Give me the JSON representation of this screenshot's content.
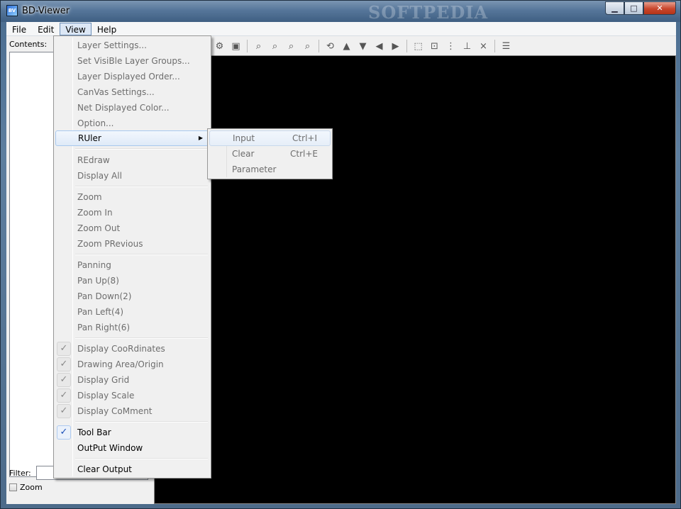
{
  "window": {
    "title": "BD-Viewer",
    "icon_text": "BV",
    "watermark": "SOFTPEDIA",
    "buttons": {
      "minimize": "▁",
      "maximize": "□",
      "close": "✕"
    }
  },
  "menubar": {
    "file": "File",
    "edit": "Edit",
    "view": "View",
    "help": "Help"
  },
  "left_panel": {
    "contents_label": "Contents:",
    "filter_label": "Filter:",
    "zoom_label": "Zoom",
    "zoom_checked": false
  },
  "view_menu": {
    "items": [
      {
        "label": "Layer Settings..."
      },
      {
        "label": "Set VisiBle Layer Groups..."
      },
      {
        "label": "Layer Displayed Order..."
      },
      {
        "label": "CanVas Settings..."
      },
      {
        "label": "Net Displayed Color..."
      },
      {
        "label": "Option..."
      },
      {
        "label": "RUler"
      },
      {
        "label": "REdraw"
      },
      {
        "label": "Display All"
      },
      {
        "label": "Zoom"
      },
      {
        "label": "Zoom In"
      },
      {
        "label": "Zoom Out"
      },
      {
        "label": "Zoom PRevious"
      },
      {
        "label": "Panning"
      },
      {
        "label": "Pan Up(8)"
      },
      {
        "label": "Pan Down(2)"
      },
      {
        "label": "Pan Left(4)"
      },
      {
        "label": "Pan Right(6)"
      },
      {
        "label": "Display CooRdinates"
      },
      {
        "label": "Drawing Area/Origin"
      },
      {
        "label": "Display Grid"
      },
      {
        "label": "Display Scale"
      },
      {
        "label": "Display CoMment"
      },
      {
        "label": "Tool Bar"
      },
      {
        "label": "OutPut Window"
      },
      {
        "label": "Clear Output"
      }
    ],
    "check_glyph": "✓"
  },
  "ruler_submenu": {
    "items": [
      {
        "label": "Input",
        "shortcut": "Ctrl+I"
      },
      {
        "label": "Clear",
        "shortcut": "Ctrl+E"
      },
      {
        "label": "Parameter",
        "shortcut": ""
      }
    ]
  },
  "toolbar": {
    "icons": [
      "settings-icon",
      "layer-icon",
      "zoom-icon",
      "zoom-in-icon",
      "zoom-out-icon",
      "zoom-previous-icon",
      "redraw-icon",
      "pan-up-icon",
      "pan-down-icon",
      "pan-left-icon",
      "pan-right-icon",
      "select-icon",
      "area-icon",
      "grid-icon",
      "scale-icon",
      "x1-icon",
      "comment-icon"
    ]
  }
}
